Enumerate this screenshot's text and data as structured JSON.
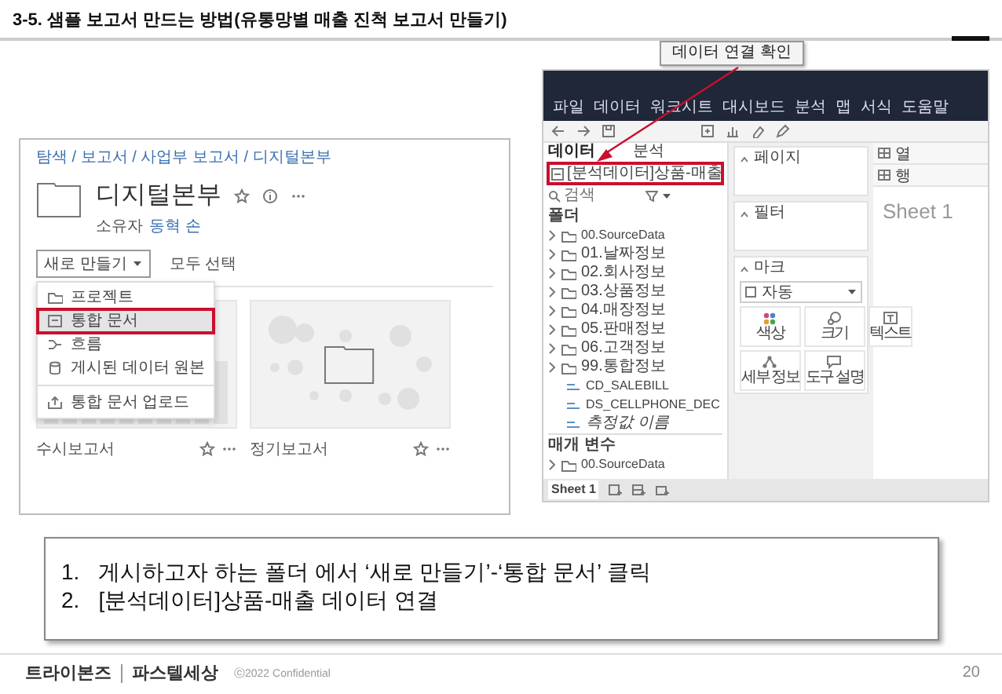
{
  "slide": {
    "title": "3-5. 샘플 보고서 만드는 방법(유통망별 매출 진척 보고서 만들기)",
    "callout": "데이터 연결 확인"
  },
  "server": {
    "breadcrumb": "탐색 / 보고서 / 사업부 보고서 / 디지털본부",
    "folder_title": "디지털본부",
    "owner_label": "소유자",
    "owner": "동혁 손",
    "new_button": "새로 만들기",
    "select_all": "모두 선택",
    "menu": [
      {
        "label": "프로젝트",
        "kind": "project",
        "selected": false,
        "highlighted": false,
        "separated": false
      },
      {
        "label": "통합 문서",
        "kind": "workbook",
        "selected": true,
        "highlighted": true,
        "separated": false
      },
      {
        "label": "흐름",
        "kind": "flow",
        "selected": false,
        "highlighted": false,
        "separated": false
      },
      {
        "label": "게시된 데이터 원본",
        "kind": "datasource",
        "selected": false,
        "highlighted": false,
        "separated": false
      },
      {
        "label": "통합 문서 업로드",
        "kind": "upload",
        "selected": false,
        "highlighted": false,
        "separated": true
      }
    ],
    "cards": [
      {
        "name": "수시보고서",
        "kind": "bars"
      },
      {
        "name": "정기보고서",
        "kind": "bubbles"
      }
    ]
  },
  "tableau": {
    "menu": [
      "파일",
      "데이터",
      "워크시트",
      "대시보드",
      "분석",
      "맵",
      "서식",
      "도움말"
    ],
    "data_tabs": [
      {
        "label": "데이터",
        "selected": true
      },
      {
        "label": "분석",
        "selected": false
      }
    ],
    "data_source": {
      "label": "[분석데이터]상품-매출",
      "highlighted": true
    },
    "search": {
      "placeholder": "검색"
    },
    "fields_header": "폴더",
    "fields": [
      {
        "label": "00.SourceData",
        "kind": "folder"
      },
      {
        "label": "01.날짜정보",
        "kind": "folder"
      },
      {
        "label": "02.회사정보",
        "kind": "folder"
      },
      {
        "label": "03.상품정보",
        "kind": "folder"
      },
      {
        "label": "04.매장정보",
        "kind": "folder"
      },
      {
        "label": "05.판매정보",
        "kind": "folder"
      },
      {
        "label": "06.고객정보",
        "kind": "folder"
      },
      {
        "label": "99.통합정보",
        "kind": "folder"
      },
      {
        "label": "CD_SALEBILL",
        "kind": "field"
      },
      {
        "label": "DS_CELLPHONE_DEC",
        "kind": "field"
      },
      {
        "label": "측정값 이름",
        "kind": "measure_names"
      }
    ],
    "parameters_header": "매개 변수",
    "parameters": [
      {
        "label": "00.SourceData",
        "kind": "folder"
      }
    ],
    "cards": [
      "페이지",
      "필터",
      "마크"
    ],
    "mark_type": "자동",
    "mark_buttons": [
      {
        "label": "색상",
        "kind": "color"
      },
      {
        "label": "크기",
        "kind": "size"
      },
      {
        "label": "텍스트",
        "kind": "text"
      },
      {
        "label": "세부 정보",
        "kind": "detail"
      },
      {
        "label": "도구 설명",
        "kind": "tooltip"
      }
    ],
    "shelves": [
      "열",
      "행"
    ],
    "sheet_title": "Sheet 1",
    "sheet_tabs": [
      {
        "label": "Sheet 1",
        "selected": true
      }
    ]
  },
  "notes": [
    {
      "number": "1.",
      "text": "게시하고자 하는 폴더 에서 ‘새로 만들기’-‘통합 문서’ 클릭"
    },
    {
      "number": "2.",
      "text": "[분석데이터]상품-매출 데이터 연결"
    }
  ],
  "footer": {
    "brand": "트라이본즈",
    "brand_2": "파스텔세상",
    "copyright": "ⓒ2022 Confidential",
    "page": "20"
  }
}
